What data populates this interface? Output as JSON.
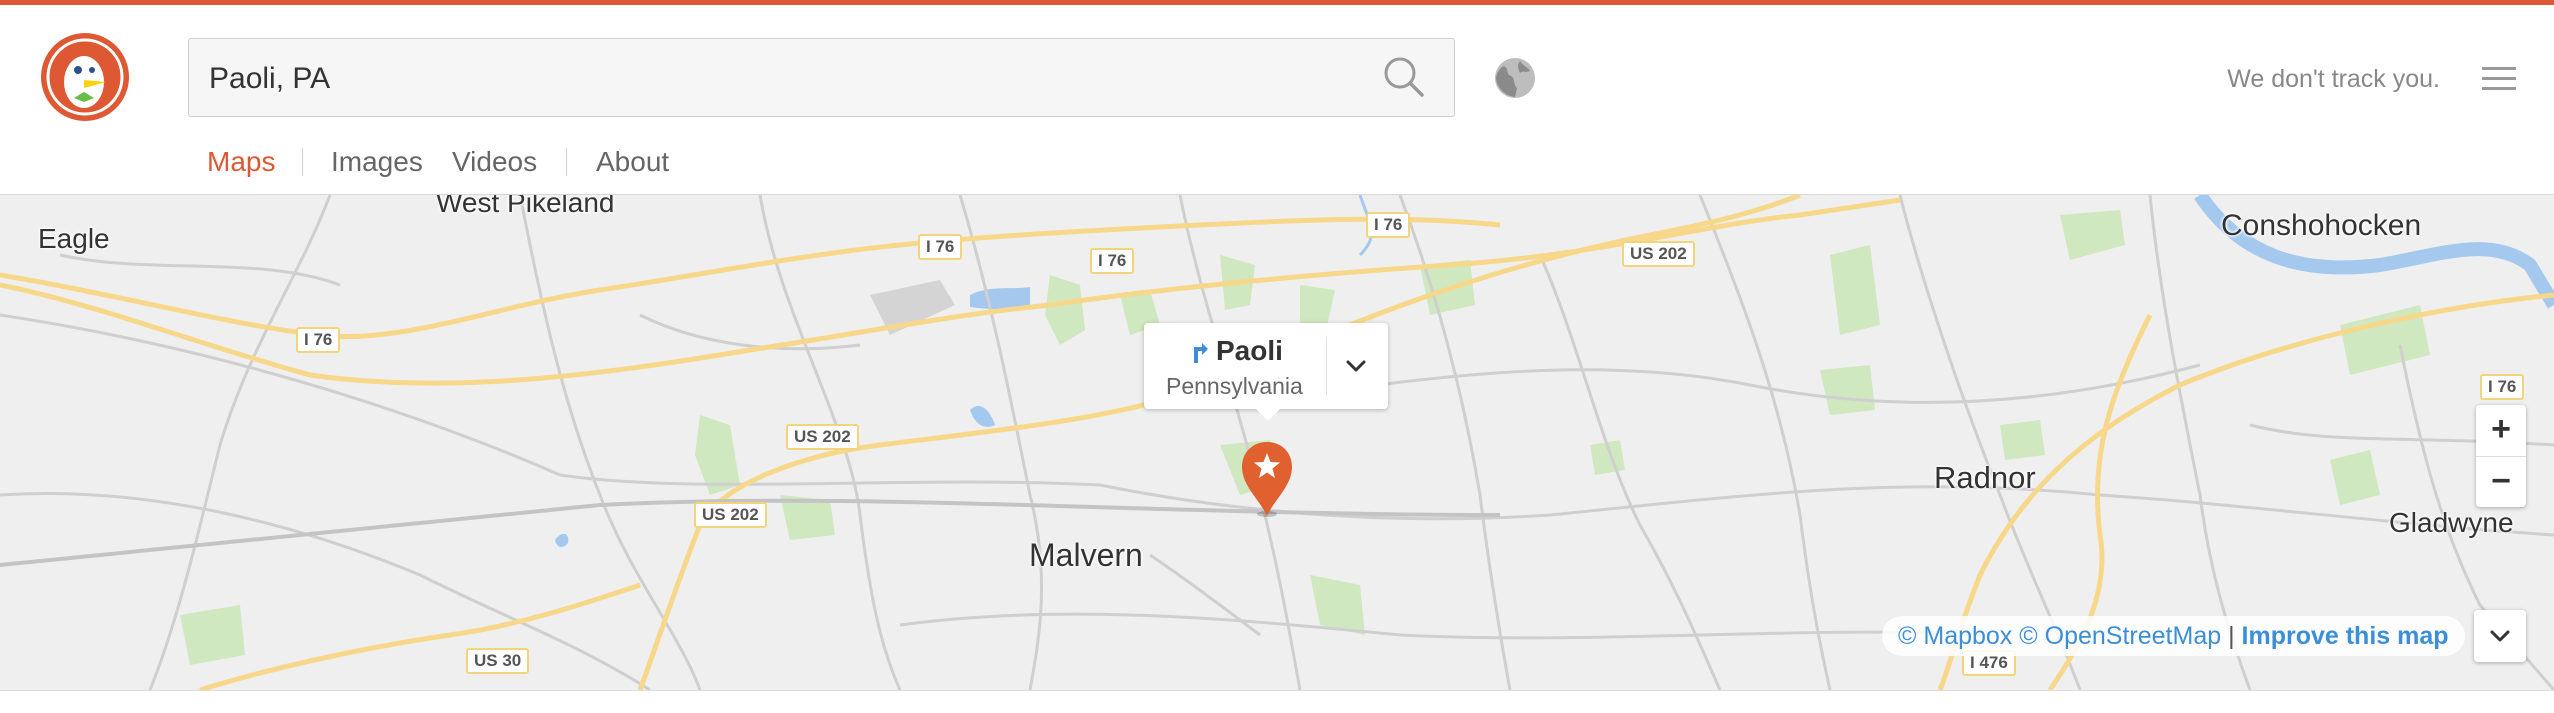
{
  "colors": {
    "accent": "#de5833",
    "link": "#3b8fd9",
    "road_major": "#f7d88a",
    "park": "#c8e6b0",
    "water": "#a5c8ef"
  },
  "search": {
    "value": "Paoli, PA"
  },
  "header": {
    "tagline": "We don't track you."
  },
  "nav": {
    "items": [
      {
        "label": "Maps",
        "active": true
      },
      {
        "label": "Images"
      },
      {
        "label": "Videos"
      },
      {
        "label": "About"
      }
    ]
  },
  "map": {
    "places": [
      {
        "label": "West Pikeland"
      },
      {
        "label": "Eagle"
      },
      {
        "label": "Conshohocken"
      },
      {
        "label": "Radnor"
      },
      {
        "label": "Gladwyne"
      },
      {
        "label": "Malvern"
      }
    ],
    "shields": [
      "I 76",
      "I 76",
      "I 76",
      "US 202",
      "I 76",
      "US 202",
      "US 202",
      "I 76",
      "US 30",
      "I 476"
    ],
    "popup": {
      "title": "Paoli",
      "subtitle": "Pennsylvania"
    },
    "zoom": {
      "in": "+",
      "out": "−"
    },
    "attribution": {
      "mapbox": "© Mapbox",
      "osm": "© OpenStreetMap",
      "separator": "|",
      "improve": "Improve this map"
    }
  }
}
